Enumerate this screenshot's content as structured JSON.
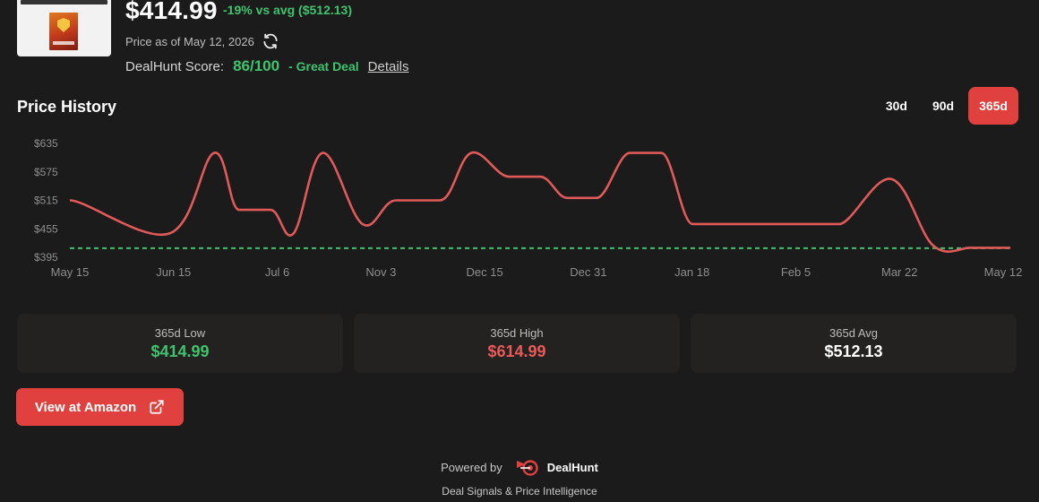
{
  "product": {
    "price": "$414.99",
    "vs_avg": "-19% vs avg ($512.13)",
    "price_as_of": "Price as of May 12, 2026"
  },
  "score": {
    "label": "DealHunt Score:",
    "value": "86/100",
    "verdict": "- Great Deal",
    "details_link": "Details"
  },
  "history": {
    "title": "Price History",
    "ranges": [
      "30d",
      "90d",
      "365d"
    ],
    "active_range": "365d"
  },
  "chart_data": {
    "type": "line",
    "x_ticks": [
      "May 15",
      "Jun 15",
      "Jul 6",
      "Nov 3",
      "Dec 15",
      "Dec 31",
      "Jan 18",
      "Feb 5",
      "Mar 22",
      "May 12"
    ],
    "y_ticks": [
      "$635",
      "$575",
      "$515",
      "$455",
      "$395"
    ],
    "ylim": [
      395,
      635
    ],
    "x_positions": [
      0,
      9.5,
      13.8,
      16.2,
      19.2,
      21.4,
      24.2,
      28.0,
      31.2,
      35.4,
      38.4,
      42.0,
      45.0,
      47.6,
      50.4,
      53.6,
      56.6,
      59.6,
      62.6,
      65.6,
      71.4,
      73.6,
      78.6,
      82.6,
      86.0,
      86.8,
      90.0
    ],
    "series": [
      {
        "values": [
          515,
          445,
          615,
          495,
          495,
          445,
          615,
          465,
          515,
          515,
          615,
          565,
          565,
          520,
          520,
          615,
          615,
          465,
          465,
          465,
          465,
          465,
          560,
          420,
          414.99,
          414.99,
          414.99
        ]
      }
    ],
    "reference_line": {
      "value": 414.99,
      "style": "dashed",
      "color": "#3ec46d"
    },
    "line_color": "#e05a57",
    "grid": false
  },
  "stats": [
    {
      "label": "365d Low",
      "value": "$414.99",
      "color": "green"
    },
    {
      "label": "365d High",
      "value": "$614.99",
      "color": "red"
    },
    {
      "label": "365d Avg",
      "value": "$512.13",
      "color": "white"
    }
  ],
  "cta": {
    "label": "View at Amazon"
  },
  "footer": {
    "powered_by": "Powered by",
    "brand": "DealHunt",
    "tagline": "Deal Signals & Price Intelligence"
  },
  "icons": {
    "refresh": "refresh-icon",
    "external_link": "external-link-icon",
    "brand_logo": "dealhunt-logo-icon"
  }
}
